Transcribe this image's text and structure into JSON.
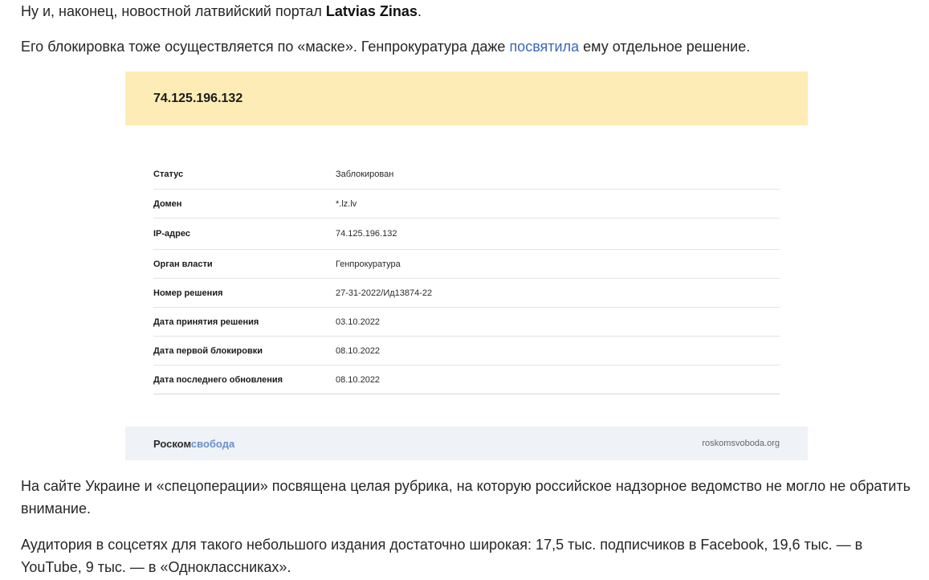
{
  "paragraphs": {
    "p1_before": "Ну и, наконец, новостной латвийский портал ",
    "p1_bold": "Latvias Zinas",
    "p1_after": ".",
    "p2_before": "Его блокировка тоже осуществляется по «маске». Генпрокуратура даже ",
    "p2_link": "посвятила",
    "p2_after": " ему отдельное решение.",
    "p3": "На сайте Украине и «спецоперации» посвящена целая рубрика, на которую российское надзорное ведомство не могло не обратить внимание.",
    "p4": "Аудитория в соцсетях для такого небольшого издания достаточно широкая: 17,5 тыс. подписчиков в Facebook, 19,6 тыс. — в YouTube, 9 тыс. — в «Одноклассниках»."
  },
  "card": {
    "header_ip": "74.125.196.132",
    "rows": [
      {
        "key": "Статус",
        "value": "Заблокирован"
      },
      {
        "key": "Домен",
        "value": "*.lz.lv"
      },
      {
        "key": "IP-адрес",
        "value": "74.125.196.132"
      },
      {
        "key": "Орган власти",
        "value": "Генпрокуратура"
      },
      {
        "key": "Номер решения",
        "value": "27-31-2022/Ид13874-22"
      },
      {
        "key": "Дата принятия решения",
        "value": "03.10.2022"
      },
      {
        "key": "Дата первой блокировки",
        "value": "08.10.2022"
      },
      {
        "key": "Дата последнего обновления",
        "value": "08.10.2022"
      }
    ],
    "footer": {
      "brand_part1": "Роском",
      "brand_part2": "свобода",
      "url": "roskomsvoboda.org"
    }
  },
  "colors": {
    "header_bg": "#fdecb5",
    "footer_bg": "#eff2f7",
    "link": "#3a67b8",
    "brand_accent": "#6b8fce"
  }
}
